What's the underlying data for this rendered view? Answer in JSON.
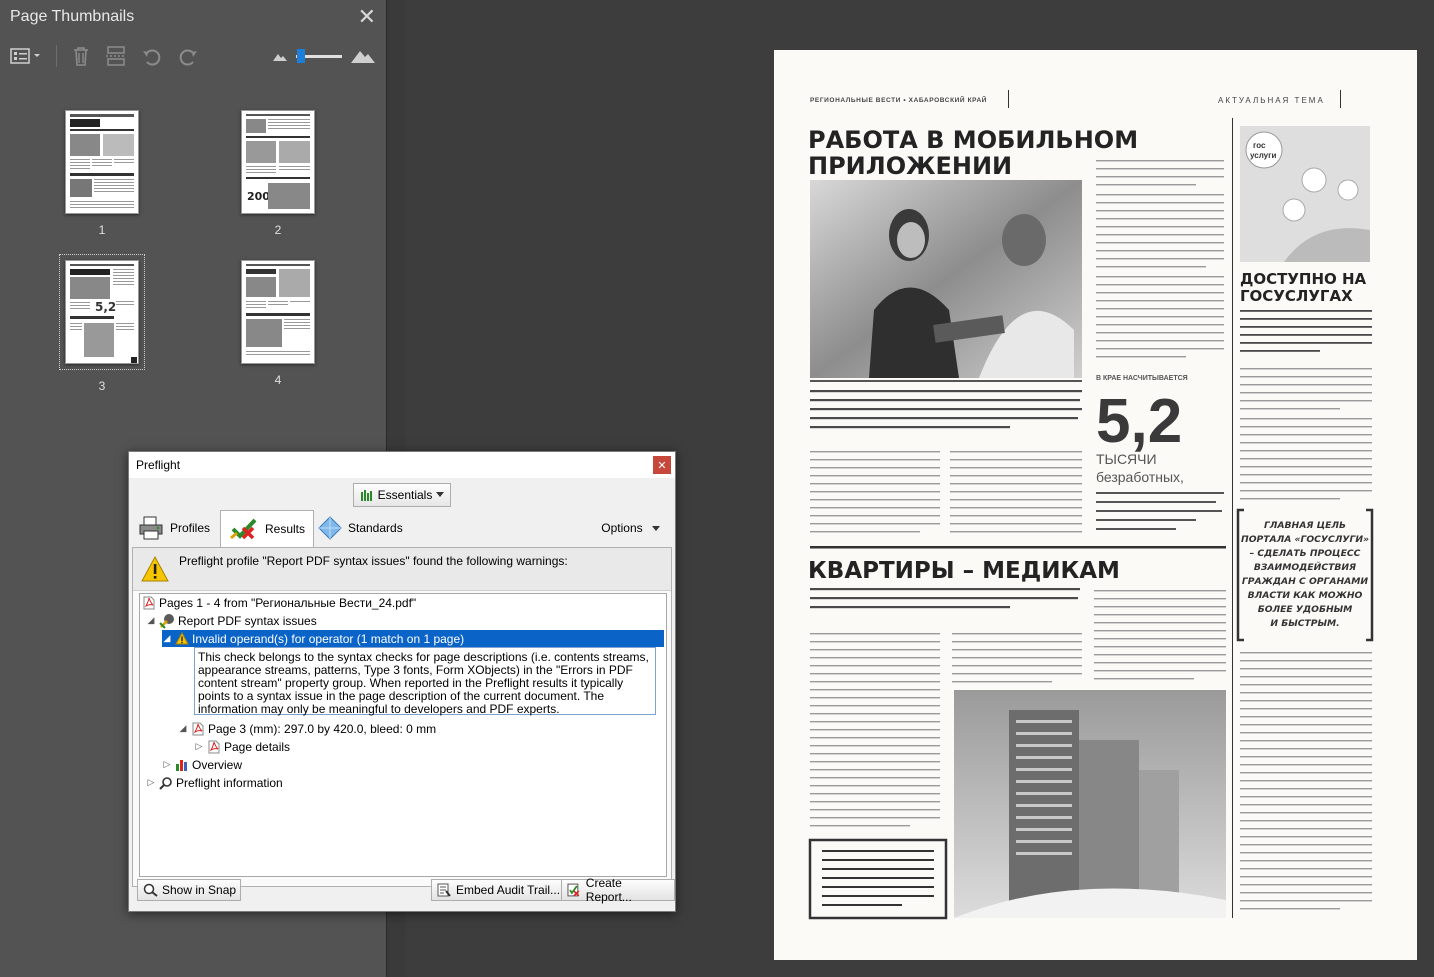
{
  "thumbnails": {
    "title": "Page Thumbnails",
    "close_glyph": "✕",
    "pages": [
      {
        "label": "1"
      },
      {
        "label": "2"
      },
      {
        "label": "3"
      },
      {
        "label": "4"
      }
    ],
    "zoom_level": 0.1
  },
  "preflight": {
    "title": "Preflight",
    "close_glyph": "✕",
    "library": "Essentials",
    "tabs": {
      "profiles": "Profiles",
      "results": "Results",
      "standards": "Standards"
    },
    "options": "Options",
    "warning": "Preflight profile \"Report PDF syntax issues\" found the following warnings:",
    "tree": {
      "file": "Pages 1 - 4 from \"Региональные Вести_24.pdf\"",
      "profile": "Report PDF syntax issues",
      "issue": "Invalid operand(s) for operator (1 match on 1 page)",
      "description": "This check belongs to the syntax checks for page descriptions (i.e. contents streams, appearance streams, patterns, Type 3 fonts, Form XObjects) in the \"Errors in PDF content stream\" property group. When reported in the Preflight results it typically points to a syntax issue in the page description of the current document. The information may only be meaningful to developers and PDF experts.",
      "page": "Page 3 (mm): 297.0 by 420.0, bleed: 0 mm",
      "page_details": "Page details",
      "overview": "Overview",
      "info": "Preflight information"
    },
    "buttons": {
      "snap": "Show in Snap",
      "embed": "Embed Audit Trail...",
      "report": "Create Report..."
    }
  },
  "newspaper": {
    "header_left": "РЕГИОНАЛЬНЫЕ ВЕСТИ • ХАБАРОВСКИЙ КРАЙ",
    "header_right": "АКТУАЛЬНАЯ ТЕМА",
    "headline1_line1": "РАБОТА В МОБИЛЬНОМ",
    "headline1_line2": "ПРИЛОЖЕНИИ",
    "big_stat_prefix": "В КРАЕ НАСЧИТЫВАЕТСЯ",
    "big_stat": "5,2",
    "big_stat_unit1": "ТЫСЯЧИ",
    "big_stat_unit2": "безработных,",
    "headline2": "КВАРТИРЫ – МЕДИКАМ",
    "headline3_line1": "ДОСТУПНО НА",
    "headline3_line2": "ГОСУСЛУГАХ",
    "quote_lines": [
      "ГЛАВНАЯ ЦЕЛЬ",
      "ПОРТАЛА «ГОСУСЛУГИ»",
      "– СДЕЛАТЬ ПРОЦЕСС",
      "ВЗАИМОДЕЙСТВИЯ",
      "ГРАЖДАН С ОРГАНАМИ",
      "ВЛАСТИ КАК МОЖНО",
      "БОЛЕЕ УДОБНЫМ",
      "И БЫСТРЫМ."
    ],
    "gos_badge1": "гос",
    "gos_badge2": "услуги"
  }
}
